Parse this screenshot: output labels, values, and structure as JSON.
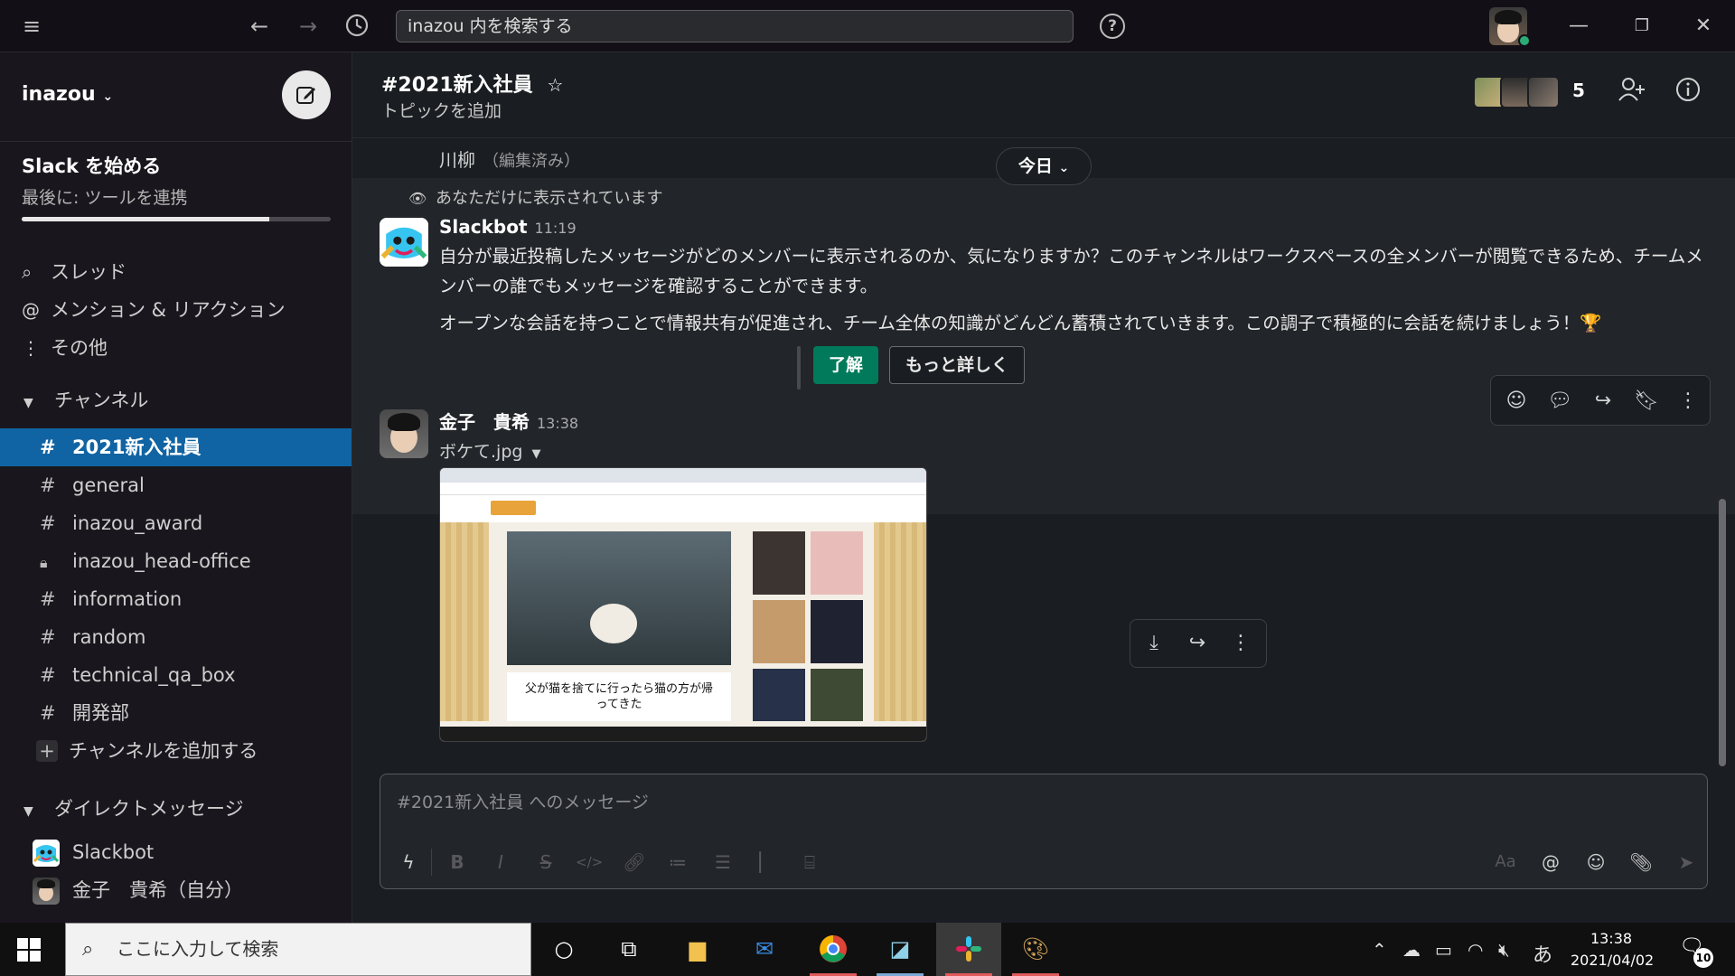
{
  "topbar": {
    "search_placeholder": "inazou 内を検索する",
    "help_label": "?"
  },
  "sidebar": {
    "workspace_name": "inazou",
    "onboarding": {
      "title": "Slack を始める",
      "subtitle": "最後に: ツールを連携",
      "progress_fraction": 0.8
    },
    "nav": [
      {
        "label": "スレッド",
        "icon": "thread-icon"
      },
      {
        "label": "メンション & リアクション",
        "icon": "at-icon"
      },
      {
        "label": "その他",
        "icon": "more-vertical-icon"
      }
    ],
    "channels_header": "チャンネル",
    "channels": [
      {
        "name": "2021新入社員",
        "type": "public",
        "active": true
      },
      {
        "name": "general",
        "type": "public"
      },
      {
        "name": "inazou_award",
        "type": "public"
      },
      {
        "name": "inazou_head-office",
        "type": "private"
      },
      {
        "name": "information",
        "type": "public"
      },
      {
        "name": "random",
        "type": "public"
      },
      {
        "name": "technical_qa_box",
        "type": "public"
      },
      {
        "name": "開発部",
        "type": "public"
      }
    ],
    "add_channel_label": "チャンネルを追加する",
    "dm_header": "ダイレクトメッセージ",
    "dms": [
      {
        "name": "Slackbot"
      },
      {
        "name": "金子　貴希（自分）"
      }
    ]
  },
  "channel": {
    "title": "#2021新入社員",
    "topic": "トピックを追加",
    "member_count": "5"
  },
  "messages": {
    "previous_line": "川柳",
    "previous_edited": "（編集済み）",
    "date_pill": "今日",
    "only_visible_to_you": "あなただけに表示されています",
    "slackbot": {
      "sender": "Slackbot",
      "time": "11:19",
      "text1": "自分が最近投稿したメッセージがどのメンバーに表示されるのか、気になりますか？このチャンネルはワークスペースの全メンバーが閲覧できるため、チームメンバーの誰でもメッセージを確認することができます。",
      "text2": "オープンな会話を持つことで情報共有が促進され、チーム全体の知識がどんどん蓄積されていきます。この調子で積極的に会話を続けましょう！🏆",
      "btn_ok": "了解",
      "btn_more": "もっと詳しく"
    },
    "user": {
      "sender": "金子　貴希",
      "time": "13:38",
      "file_name": "ボケて.jpg",
      "thumb_caption": "父が猫を捨てに行ったら猫の方が帰ってきた"
    }
  },
  "composer": {
    "placeholder": "#2021新入社員 へのメッセージ",
    "aa_label": "Aa"
  },
  "taskbar": {
    "search_placeholder": "ここに入力して検索",
    "ime": "あ",
    "time": "13:38",
    "date": "2021/04/02",
    "notification_count": "10"
  }
}
